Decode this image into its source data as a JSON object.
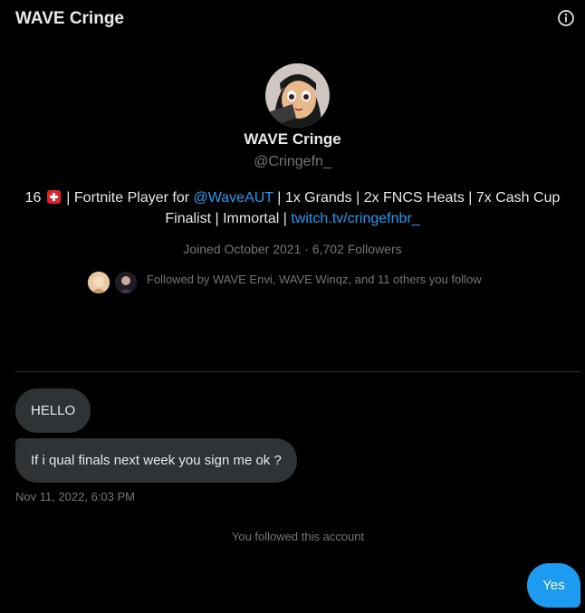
{
  "header": {
    "title": "WAVE Cringe",
    "info_icon": "info-icon"
  },
  "profile": {
    "name": "WAVE Cringe",
    "handle": "@Cringefn_",
    "bio": {
      "part1": "16 ",
      "flag": "swiss-flag-icon",
      "part2": " | Fortnite Player for ",
      "mention": "@WaveAUT",
      "part3": " | 1x Grands | 2x FNCS Heats | 7x Cash Cup Finalist | Immortal | ",
      "link": "twitch.tv/cringefnbr_"
    },
    "meta": "Joined October 2021 · 6,702 Followers",
    "followed_by": "Followed by WAVE Envi, WAVE Winqz, and 11 others you follow"
  },
  "messages": {
    "received": [
      "HELLO",
      "If i qual finals next week you sign me ok ?"
    ],
    "timestamp": "Nov 11, 2022, 6:03 PM",
    "system": "You followed this account",
    "sent": "Yes"
  },
  "colors": {
    "accent": "#1d9bf0",
    "bubble": "#2f3336",
    "muted": "#71767b"
  }
}
